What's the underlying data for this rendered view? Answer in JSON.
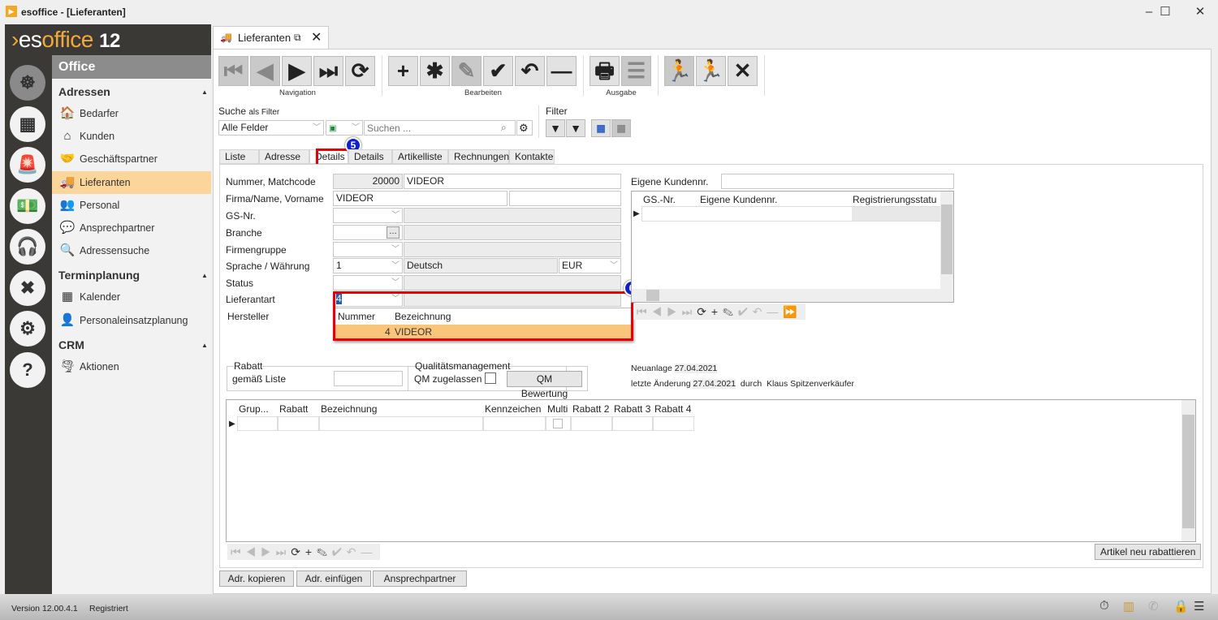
{
  "window": {
    "title": "esoffice - [Lieferanten]",
    "app_icon": "esoffice-logo-icon",
    "controls": [
      "minimize",
      "maximize",
      "close"
    ]
  },
  "brand": {
    "pre": "es",
    "mid": "office",
    "version": "12"
  },
  "side_icons": [
    "ship-wheel-icon",
    "grid-plan-icon",
    "alarm-light-icon",
    "money-icon",
    "headset-icon",
    "tools-icon",
    "gears-icon",
    "help-icon"
  ],
  "nav": {
    "header": "Office",
    "sections": [
      {
        "title": "Adressen",
        "items": [
          {
            "label": "Bedarfer",
            "icon": "🏠"
          },
          {
            "label": "Kunden",
            "icon": "⌂"
          },
          {
            "label": "Geschäftspartner",
            "icon": "🤝"
          },
          {
            "label": "Lieferanten",
            "icon": "🚚",
            "selected": true
          },
          {
            "label": "Personal",
            "icon": "👥"
          },
          {
            "label": "Ansprechpartner",
            "icon": "💬"
          },
          {
            "label": "Adressensuche",
            "icon": "🔍"
          }
        ]
      },
      {
        "title": "Terminplanung",
        "items": [
          {
            "label": "Kalender",
            "icon": "▦"
          },
          {
            "label": "Personaleinsatzplanung",
            "icon": "👤"
          }
        ]
      },
      {
        "title": "CRM",
        "items": [
          {
            "label": "Aktionen",
            "icon": "🌪"
          }
        ]
      }
    ]
  },
  "doc_tab": {
    "label": "Lieferanten"
  },
  "toolbar": {
    "groups": [
      {
        "label": "Navigation",
        "buttons": [
          {
            "name": "first",
            "g": "⏮",
            "dis": true
          },
          {
            "name": "previous",
            "g": "◀",
            "dis": true
          },
          {
            "name": "next",
            "g": "▶"
          },
          {
            "name": "last",
            "g": "⏭"
          },
          {
            "name": "refresh",
            "g": "⟳"
          }
        ]
      },
      {
        "label": "Bearbeiten",
        "buttons": [
          {
            "name": "add",
            "g": "+"
          },
          {
            "name": "new",
            "g": "✱"
          },
          {
            "name": "edit",
            "g": "✎",
            "dis": true
          },
          {
            "name": "save",
            "g": "✔"
          },
          {
            "name": "undo",
            "g": "↶"
          },
          {
            "name": "delete",
            "g": "—"
          }
        ]
      },
      {
        "label": "Ausgabe",
        "buttons": [
          {
            "name": "print",
            "g": "🖶"
          },
          {
            "name": "export",
            "g": "☰",
            "dis": true
          }
        ]
      },
      {
        "label": "",
        "buttons": [
          {
            "name": "exit-soft",
            "g": "🏃",
            "dis": true
          },
          {
            "name": "exit",
            "g": "🏃"
          },
          {
            "name": "close",
            "g": "✕"
          }
        ]
      }
    ]
  },
  "search": {
    "label": "Suche",
    "filter_hint": "als Filter",
    "field_select": "Alle Felder",
    "placeholder": "Suchen ...",
    "filter_label": "Filter"
  },
  "tabs": [
    "Liste",
    "Adresse",
    "Details",
    "Details II",
    "Artikelliste",
    "Rechnungen",
    "Kontakte"
  ],
  "active_tab": "Details",
  "badges": {
    "b5": "5",
    "b6": "6"
  },
  "form": {
    "nummer_label": "Nummer, Matchcode",
    "nummer": "20000",
    "matchcode": "VIDEOR",
    "firma_label": "Firma/Name, Vorname",
    "firma": "VIDEOR",
    "vorname": "",
    "gs_label": "GS-Nr.",
    "branche_label": "Branche",
    "firmengruppe_label": "Firmengruppe",
    "sprache_label": "Sprache / Währung",
    "sprache": "1",
    "sprache_text": "Deutsch",
    "waehrung": "EUR",
    "status_label": "Status",
    "lieferantart_label": "Lieferantart",
    "lieferantart": "4",
    "hersteller_label": "Hersteller",
    "eigene_kundennr_label": "Eigene Kundennr.",
    "eigene_kundennr": ""
  },
  "dropdown": {
    "headers": [
      "Nummer",
      "Bezeichnung"
    ],
    "rows": [
      {
        "nummer": "4",
        "bezeichnung": "VIDEOR"
      }
    ],
    "selected_color": "#f9c57a"
  },
  "gs_grid": {
    "headers": [
      "GS.-Nr.",
      "Eigene Kundennr.",
      "Registrierungsstatu"
    ]
  },
  "rabatt": {
    "group": "Rabatt",
    "label": "gemäß Liste",
    "value": ""
  },
  "qm": {
    "group": "Qualitätsmanagement",
    "label": "QM zugelassen",
    "checked": false,
    "button": "QM Bewertung"
  },
  "meta": {
    "neuanlage_label": "Neuanlage",
    "neuanlage": "27.04.2021",
    "aenderung_label": "letzte Änderung",
    "aenderung": "27.04.2021",
    "durch_label": "durch",
    "user": "Klaus Spitzenverkäufer"
  },
  "rabatt_grid": {
    "headers": [
      "Grup...",
      "Rabatt",
      "Bezeichnung",
      "Kennzeichen",
      "Multi",
      "Rabatt 2",
      "Rabatt 3",
      "Rabatt 4"
    ]
  },
  "buttons": {
    "rabattieren": "Artikel neu rabattieren",
    "kopieren": "Adr. kopieren",
    "einfuegen": "Adr. einfügen",
    "ansprechpartner": "Ansprechpartner"
  },
  "status": {
    "version": "Version 12.00.4.1",
    "registered": "Registriert",
    "icons": [
      "stopwatch-icon",
      "building-icon",
      "phone-icon",
      "lock-icon",
      "database-icon"
    ]
  },
  "colors": {
    "accent": "#f2a93b",
    "highlight": "#fbd59a",
    "annotation_red": "#e8000b",
    "badge_blue": "#1020d0"
  }
}
